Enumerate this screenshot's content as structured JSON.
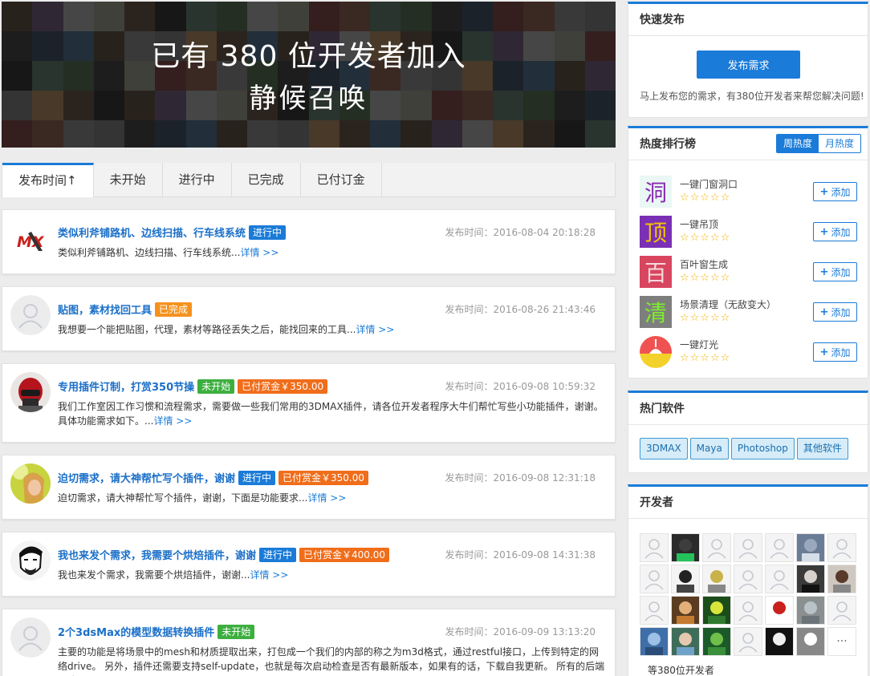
{
  "banner": {
    "line1": "已有 380 位开发者加入",
    "line2": "静候召唤"
  },
  "tabs": [
    {
      "label": "发布时间↑",
      "active": true
    },
    {
      "label": "未开始",
      "active": false
    },
    {
      "label": "进行中",
      "active": false
    },
    {
      "label": "已完成",
      "active": false
    },
    {
      "label": "已付订金",
      "active": false
    }
  ],
  "posts": [
    {
      "title": "类似利斧铺路机、边线扫描、行车线系统",
      "status": "进行中",
      "reward": "",
      "time": "发布时间：2016-08-04 20:18:28",
      "desc": "类似利斧铺路机、边线扫描、行车线系统...",
      "detail": "详情 >>"
    },
    {
      "title": "贴图，素材找回工具",
      "status": "已完成",
      "reward": "",
      "time": "发布时间：2016-08-26 21:43:46",
      "desc": "我想要一个能把贴图，代理，素材等路径丢失之后，能找回来的工具...",
      "detail": "详情 >>"
    },
    {
      "title": "专用插件订制，打赏350节操",
      "status": "未开始",
      "reward": "已付赏金￥350.00",
      "time": "发布时间：2016-09-08 10:59:32",
      "desc": "我们工作室因工作习惯和流程需求，需要做一些我们常用的3DMAX插件，请各位开发者程序大牛们帮忙写些小功能插件，谢谢。具体功能需求如下。...",
      "detail": "详情 >>"
    },
    {
      "title": "迫切需求，请大神帮忙写个插件，谢谢",
      "status": "进行中",
      "reward": "已付赏金￥350.00",
      "time": "发布时间：2016-09-08 12:31:18",
      "desc": "迫切需求，请大神帮忙写个插件，谢谢，下面是功能要求...",
      "detail": "详情 >>"
    },
    {
      "title": "我也来发个需求，我需要个烘焙插件，谢谢",
      "status": "进行中",
      "reward": "已付赏金￥400.00",
      "time": "发布时间：2016-09-08 14:31:38",
      "desc": "我也来发个需求，我需要个烘焙插件，谢谢...",
      "detail": "详情 >>"
    },
    {
      "title": "2个3dsMax的模型数据转换插件",
      "status": "未开始",
      "reward": "",
      "time": "发布时间：2016-09-09 13:13:20",
      "desc": "主要的功能是将场景中的mesh和材质提取出来，打包成一个我们的内部的称之为m3d格式，通过restful接口，上传到特定的网络drive。 另外，插件还需要支持self-update，也就是每次启动检查是否有最新版本，如果有的话，下载自我更新。 所有的后端网络",
      "detail": ""
    }
  ],
  "publish": {
    "heading": "快速发布",
    "button": "发布需求",
    "note": "马上发布您的需求，有380位开发者来帮您解决问题!"
  },
  "ranking": {
    "heading": "热度排行榜",
    "toggle_week": "周热度",
    "toggle_month": "月热度",
    "stars": "☆☆☆☆☆",
    "add_label": "添加",
    "items": [
      {
        "icon_char": "洞",
        "name": "一键门窗洞口",
        "color": "#8a2bb0",
        "bg": "#eaf7f4"
      },
      {
        "icon_char": "顶",
        "name": "一键吊顶",
        "color": "#f5c400",
        "bg": "#7a2fb5"
      },
      {
        "icon_char": "百",
        "name": "百叶窗生成",
        "color": "#f7d7dc",
        "bg": "#d8455f"
      },
      {
        "icon_char": "清",
        "name": "场景清理（无敌变大）",
        "color": "#7cf02a",
        "bg": "#7e7e7e"
      },
      {
        "icon_char": "",
        "name": "一键灯光",
        "color": "#f2b800",
        "bg": "#f0f0f0"
      }
    ]
  },
  "software": {
    "heading": "热门软件",
    "items": [
      "3DMAX",
      "Maya",
      "Photoshop",
      "其他软件"
    ]
  },
  "developers": {
    "heading": "开发者",
    "more": "···",
    "count_label": "等380位开发者"
  },
  "colors": {
    "accent": "#1a7bd8",
    "status_in_progress": "#1a7bd8",
    "status_done": "#f5921e",
    "status_not_started": "#3daf3f",
    "reward": "#f06d1a"
  }
}
